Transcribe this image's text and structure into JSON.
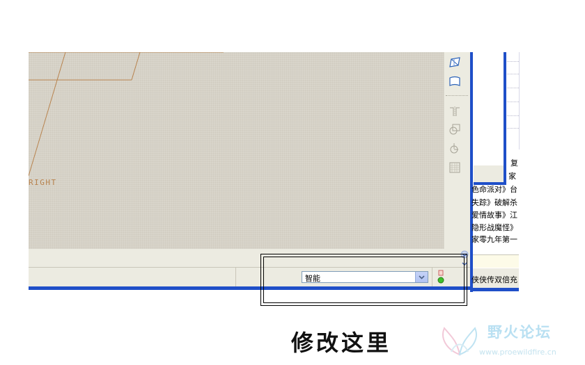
{
  "graphics": {
    "datum_label": "RIGHT"
  },
  "toolbar": {
    "icons": [
      "view-orient-icon",
      "saved-view-icon",
      "mirror-icon",
      "datum-plane-icon",
      "datum-axis-icon",
      "grid-icon"
    ]
  },
  "status_bar": {
    "filter_value": "智能",
    "filter_options": [
      "智能"
    ]
  },
  "background_window": {
    "news_lines": [
      "色命派对》台",
      "失踪》破解杀",
      "爱情故事》江",
      "隐形战魔怪》",
      "家零九年第一"
    ],
    "corner_text": "复",
    "side_text": "家",
    "bottom_text": "侠侠传双倍充"
  },
  "annotation": {
    "caption": "修改这里"
  },
  "watermark": {
    "title": "野火论坛",
    "url": "www.proewildfire.cn"
  },
  "colors": {
    "frame_blue": "#1f4fc8",
    "sketch_line": "#b8834e",
    "toolbar_bg": "#ecebe1"
  }
}
